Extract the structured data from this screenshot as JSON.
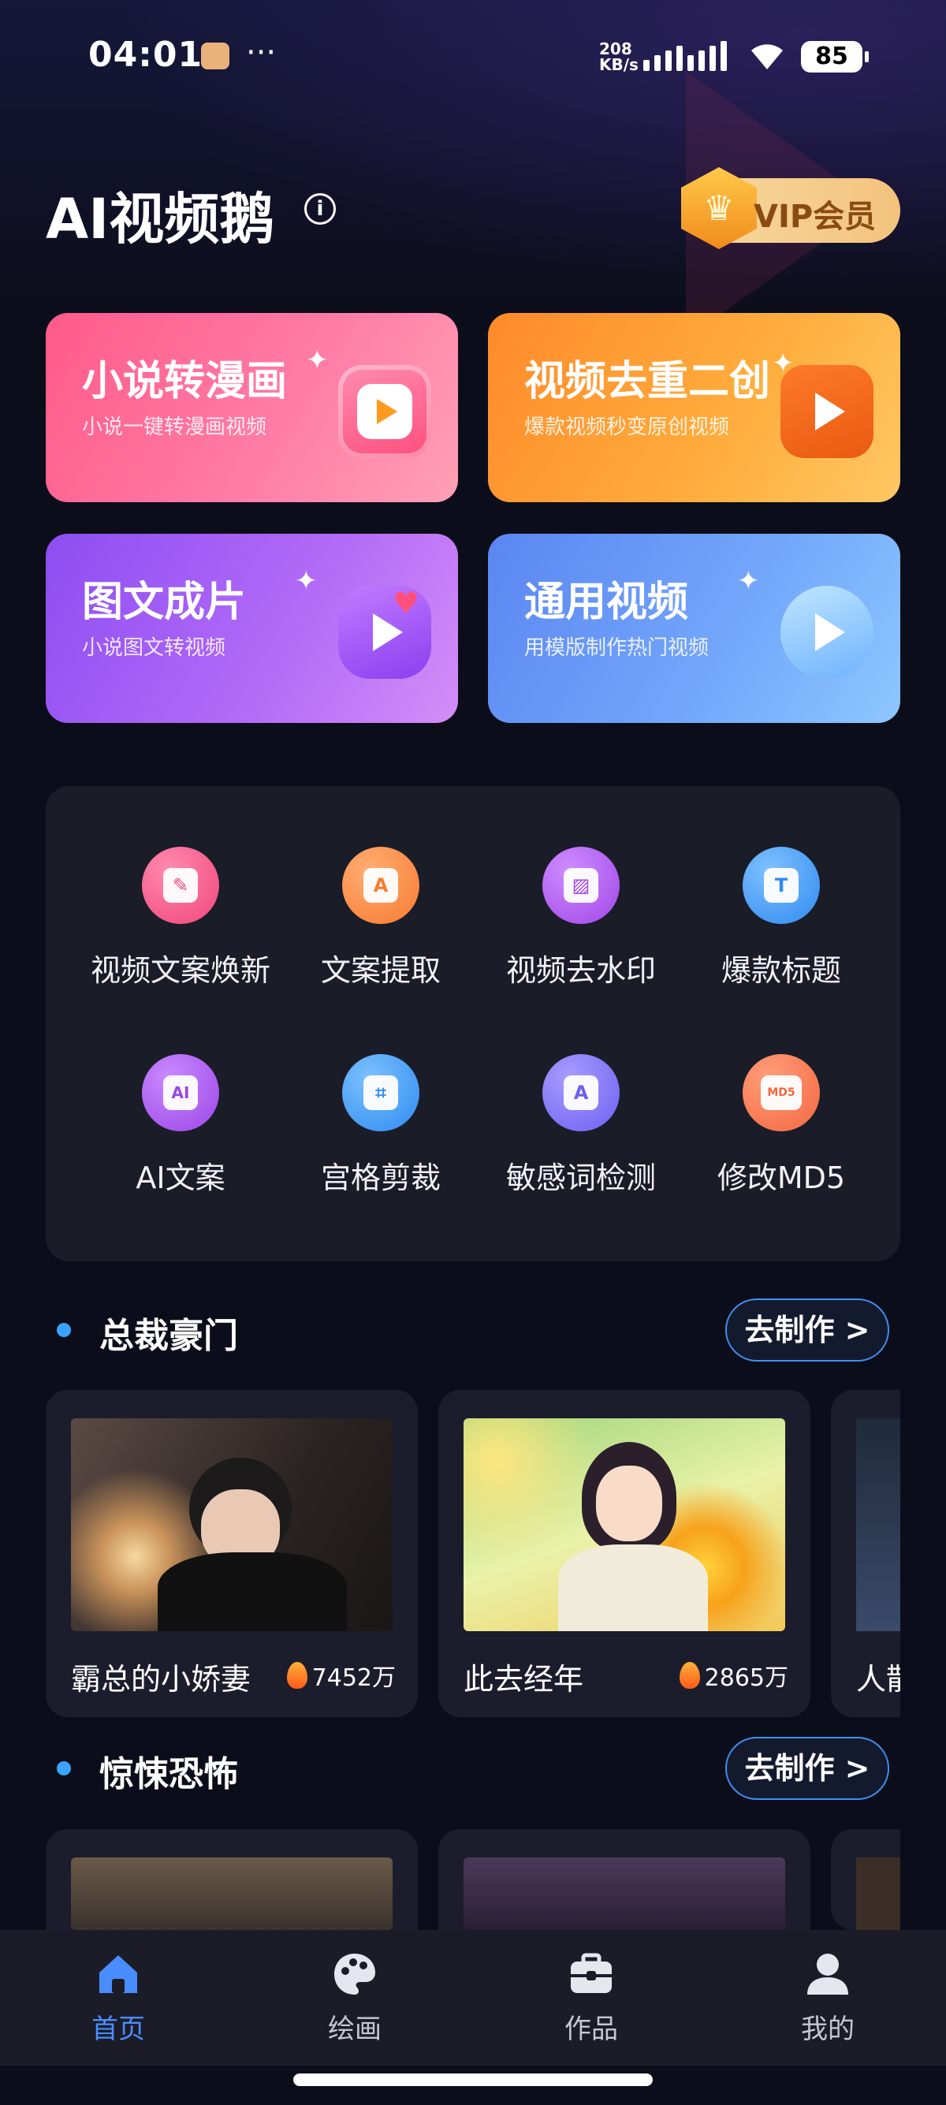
{
  "status_bar": {
    "time": "04:01",
    "dots": "···",
    "net_speed_value": "208",
    "net_speed_unit": "KB/s",
    "battery": "85"
  },
  "header": {
    "app_title": "AI视频鹅",
    "info_icon": "info-icon",
    "vip_label": "VIP会员",
    "vip_badge_icon": "crown-icon"
  },
  "feature_cards": [
    {
      "title": "小说转漫画",
      "subtitle": "小说一键转漫画视频",
      "icon": "tv-play-icon"
    },
    {
      "title": "视频去重二创",
      "subtitle": "爆款视频秒变原创视频",
      "icon": "play-icon"
    },
    {
      "title": "图文成片",
      "subtitle": "小说图文转视频",
      "icon": "chat-play-icon"
    },
    {
      "title": "通用视频",
      "subtitle": "用模版制作热门视频",
      "icon": "3d-play-icon"
    }
  ],
  "tools": [
    {
      "label": "视频文案焕新",
      "icon": "pencil-icon",
      "glyph": "✎",
      "color": "#f0457a"
    },
    {
      "label": "文案提取",
      "icon": "text-extract-icon",
      "glyph": "A",
      "color": "#f77a30"
    },
    {
      "label": "视频去水印",
      "icon": "image-watermark-icon",
      "glyph": "▨",
      "color": "#a046e8"
    },
    {
      "label": "爆款标题",
      "icon": "title-icon",
      "glyph": "T",
      "color": "#2f8af0"
    },
    {
      "label": "AI文案",
      "icon": "ai-doc-icon",
      "glyph": "AI",
      "color": "#9b45e6"
    },
    {
      "label": "宫格剪裁",
      "icon": "crop-icon",
      "glyph": "⌗",
      "color": "#2e8cf0"
    },
    {
      "label": "敏感词检测",
      "icon": "doc-check-icon",
      "glyph": "A",
      "color": "#6e5ff0"
    },
    {
      "label": "修改MD5",
      "icon": "md5-icon",
      "glyph": "MD5",
      "color": "#f3663f"
    }
  ],
  "sections": [
    {
      "title": "总裁豪门",
      "button": "去制作 >",
      "items": [
        {
          "name": "霸总的小娇妻",
          "heat": "7452万"
        },
        {
          "name": "此去经年",
          "heat": "2865万"
        },
        {
          "name": "人散"
        }
      ]
    },
    {
      "title": "惊悚恐怖",
      "button": "去制作 >"
    }
  ],
  "tabbar": [
    {
      "label": "首页",
      "icon": "home-icon",
      "active": true
    },
    {
      "label": "绘画",
      "icon": "palette-icon",
      "active": false
    },
    {
      "label": "作品",
      "icon": "briefcase-icon",
      "active": false
    },
    {
      "label": "我的",
      "icon": "user-icon",
      "active": false
    }
  ],
  "colors": {
    "background": "#0c0d1a",
    "accent": "#4a8dff",
    "section_dot": "#3aa3ff"
  }
}
